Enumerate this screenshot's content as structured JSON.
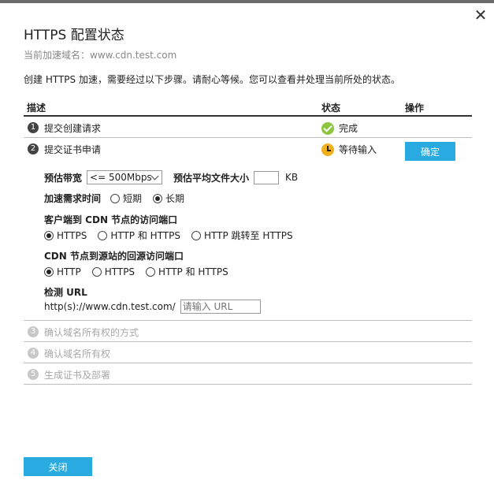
{
  "dialog": {
    "title": "HTTPS 配置状态",
    "subtitle": "当前加速域名：www.cdn.test.com",
    "description": "创建 HTTPS 加速，需要经过以下步骤。请耐心等候。您可以查看并处理当前所处的状态。",
    "close_label": "关闭"
  },
  "table": {
    "headers": {
      "desc": "描述",
      "status": "状态",
      "op": "操作"
    },
    "steps": [
      {
        "num": "1",
        "label": "提交创建请求",
        "status": "完成"
      },
      {
        "num": "2",
        "label": "提交证书申请",
        "status": "等待输入",
        "action": "确定"
      },
      {
        "num": "3",
        "label": "确认域名所有权的方式"
      },
      {
        "num": "4",
        "label": "确认域名所有权"
      },
      {
        "num": "5",
        "label": "生成证书及部署"
      }
    ]
  },
  "form": {
    "bandwidth_label": "预估带宽",
    "bandwidth_value": "<= 500Mbps",
    "avg_file_label": "预估平均文件大小",
    "avg_file_unit": "KB",
    "accel_time_label": "加速需求时间",
    "accel_short": "短期",
    "accel_long": "长期",
    "client_port_label": "客户端到 CDN 节点的访问端口",
    "client_opt1": "HTTPS",
    "client_opt2": "HTTP 和 HTTPS",
    "client_opt3": "HTTP 跳转至 HTTPS",
    "origin_port_label": "CDN 节点到源站的回源访问端口",
    "origin_opt1": "HTTP",
    "origin_opt2": "HTTPS",
    "origin_opt3": "HTTP 和 HTTPS",
    "check_url_label": "检测 URL",
    "check_url_prefix": "http(s)://www.cdn.test.com/",
    "check_url_placeholder": "请输入 URL"
  },
  "colors": {
    "accent": "#29abe2",
    "ok": "#8cc63f",
    "wait": "#f2b01e"
  }
}
